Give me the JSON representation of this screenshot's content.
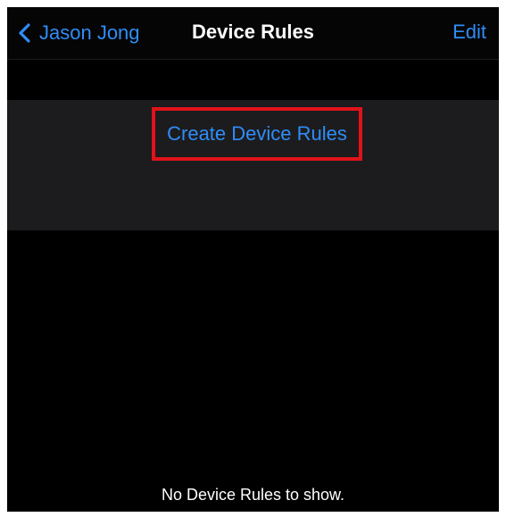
{
  "nav": {
    "back_label": "Jason Jong",
    "title": "Device Rules",
    "edit_label": "Edit"
  },
  "section": {
    "create_label": "Create Device Rules"
  },
  "empty_state": {
    "message": "No Device Rules to show."
  },
  "colors": {
    "accent": "#2f8df7",
    "background": "#000000",
    "section_bg": "#1c1c1e",
    "highlight_border": "#e0131a"
  },
  "icons": {
    "back": "chevron-left-icon"
  }
}
